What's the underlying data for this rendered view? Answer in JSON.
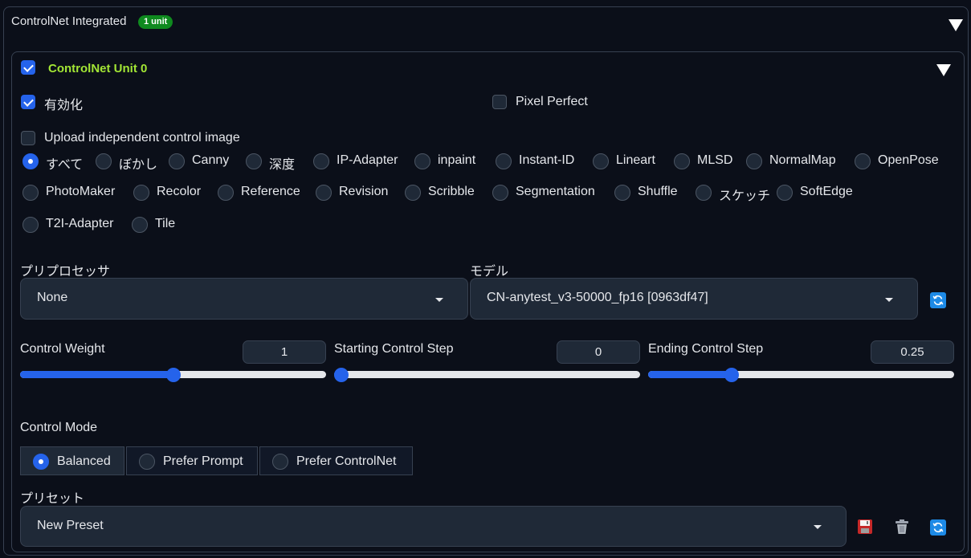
{
  "header": {
    "title": "ControlNet Integrated",
    "badge": "1 unit"
  },
  "unit": {
    "title": "ControlNet Unit 0",
    "enabled_checkbox": true
  },
  "options": {
    "enable_label": "有効化",
    "enable_checked": true,
    "pixel_perfect_label": "Pixel Perfect",
    "pixel_perfect_checked": false,
    "upload_label": "Upload independent control image",
    "upload_checked": false
  },
  "control_types": [
    {
      "label": "すべて",
      "selected": true
    },
    {
      "label": "ぼかし"
    },
    {
      "label": "Canny"
    },
    {
      "label": "深度"
    },
    {
      "label": "IP-Adapter"
    },
    {
      "label": "inpaint"
    },
    {
      "label": "Instant-ID"
    },
    {
      "label": "Lineart"
    },
    {
      "label": "MLSD"
    },
    {
      "label": "NormalMap"
    },
    {
      "label": "OpenPose"
    },
    {
      "label": "PhotoMaker"
    },
    {
      "label": "Recolor"
    },
    {
      "label": "Reference"
    },
    {
      "label": "Revision"
    },
    {
      "label": "Scribble"
    },
    {
      "label": "Segmentation"
    },
    {
      "label": "Shuffle"
    },
    {
      "label": "スケッチ"
    },
    {
      "label": "SoftEdge"
    },
    {
      "label": "T2I-Adapter"
    },
    {
      "label": "Tile"
    }
  ],
  "preprocessor": {
    "label": "プリプロセッサ",
    "value": "None"
  },
  "model": {
    "label": "モデル",
    "value": "CN-anytest_v3-50000_fp16 [0963df47]"
  },
  "sliders": {
    "weight": {
      "label": "Control Weight",
      "value": "1",
      "fraction": 0.5
    },
    "start": {
      "label": "Starting Control Step",
      "value": "0",
      "fraction": 0.0
    },
    "end": {
      "label": "Ending Control Step",
      "value": "0.25",
      "fraction": 0.263
    }
  },
  "control_mode": {
    "label": "Control Mode",
    "options": [
      "Balanced",
      "Prefer Prompt",
      "Prefer ControlNet"
    ],
    "selected": "Balanced"
  },
  "preset": {
    "label": "プリセット",
    "value": "New Preset"
  },
  "icons": [
    "chevron-down-icon",
    "refresh-icon",
    "save-icon",
    "trash-icon"
  ],
  "colors": {
    "accent": "#2563eb",
    "badge": "#0f8a1f",
    "unit_title": "#a3e635",
    "background": "#0b0f19"
  }
}
